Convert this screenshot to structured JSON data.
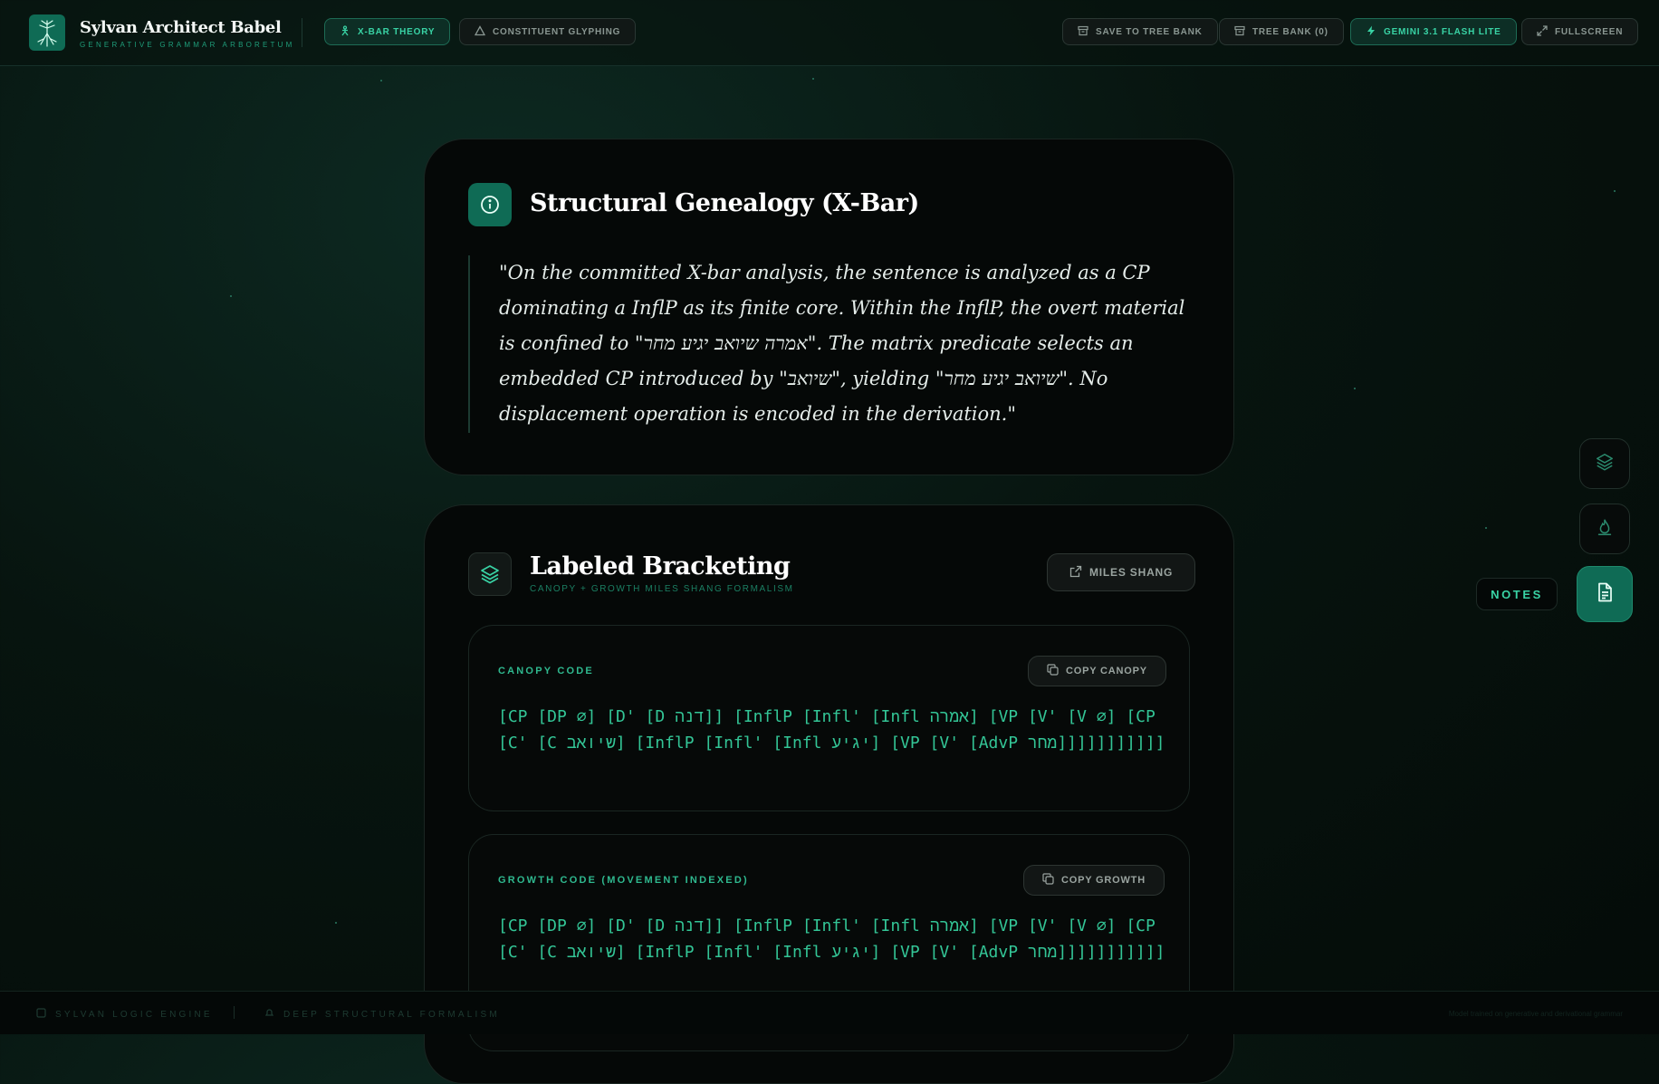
{
  "app": {
    "title": "Sylvan Architect Babel",
    "subtitle": "GENERATIVE GRAMMAR ARBORETUM"
  },
  "modes": [
    {
      "label": "X-BAR THEORY",
      "icon": "person-tree-icon",
      "active": true
    },
    {
      "label": "CONSTITUENT GLYPHING",
      "icon": "triangle-icon",
      "active": false
    }
  ],
  "toolbar": {
    "save_label": "SAVE TO TREE BANK",
    "bank_label": "TREE BANK (0)",
    "model_label": "GEMINI 3.1 FLASH LITE",
    "fullscreen_label": "FULLSCREEN"
  },
  "genealogy": {
    "title": "Structural Genealogy (X-Bar)",
    "quote": "\"On the committed X-bar analysis, the sentence is analyzed as a CP dominating a InflP as its finite core. Within the InflP, the overt material is confined to \"אמרה שיואב יגיע מחר\". The matrix predicate selects an embedded CP introduced by \"שיואב\", yielding \"שיואב יגיע מחר\". No displacement operation is encoded in the derivation.\""
  },
  "bracketing": {
    "title": "Labeled Bracketing",
    "subtitle": "CANOPY + GROWTH MILES SHANG FORMALISM",
    "link_label": "MILES SHANG",
    "canopy": {
      "label": "CANOPY CODE",
      "copy_label": "COPY CANOPY",
      "code": "[CP [DP ∅] [D' [D דנה]] [InflP [Infl' [Infl אמרה] [VP [V' [V ∅] [CP [C' [C שיואב] [InflP [Infl' [Infl יגיע] [VP [V' [AdvP מחר]]]]]]]]]]]"
    },
    "growth": {
      "label": "GROWTH CODE (MOVEMENT INDEXED)",
      "copy_label": "COPY GROWTH",
      "code": "[CP [DP ∅] [D' [D דנה]] [InflP [Infl' [Infl אמרה] [VP [V' [V ∅] [CP [C' [C שיואב] [InflP [Infl' [Infl יגיע] [VP [V' [AdvP מחר]]]]]]]]]]]"
    }
  },
  "side_panel": {
    "notes_label": "NOTES",
    "buttons": [
      "layers-icon",
      "flame-icon",
      "document-icon"
    ]
  },
  "footer": {
    "left_1": "SYLVAN LOGIC ENGINE",
    "left_2": "DEEP STRUCTURAL FORMALISM",
    "right": "Model trained on generative and derivational grammar"
  },
  "colors": {
    "accent": "#39d3a5",
    "accent_dark": "#0f6b55",
    "background": "#07140f",
    "card": "#050807"
  }
}
